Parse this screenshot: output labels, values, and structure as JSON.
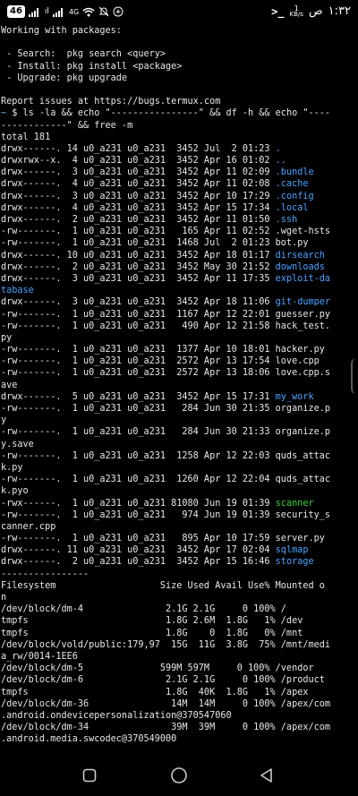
{
  "status_bar": {
    "battery": "46",
    "time": "١:٣٢",
    "ampm": "ص",
    "net_speed_value": "1",
    "net_speed_unit": "KB/s",
    "terminal_indicator": ">_",
    "signal_1": "ıl",
    "network_type": "4G"
  },
  "terminal": {
    "lines": [
      {
        "text": "Working with packages:",
        "cls": ""
      },
      {
        "text": "",
        "cls": ""
      },
      {
        "text": " - Search:  pkg search <query>",
        "cls": ""
      },
      {
        "text": " - Install: pkg install <package>",
        "cls": ""
      },
      {
        "text": " - Upgrade: pkg upgrade",
        "cls": ""
      },
      {
        "text": "",
        "cls": ""
      },
      {
        "text": "Report issues at https://bugs.termux.com",
        "cls": ""
      },
      {
        "text": "~ $ ls -la && echo \"----------------\" && df -h && echo \"----",
        "cls": "prompt"
      },
      {
        "text": "------------\" && free -m",
        "cls": ""
      },
      {
        "text": "total 181",
        "cls": ""
      },
      {
        "text": "drwx------. 14 u0_a231 u0_a231  3452 Jul  2 01:23 .",
        "cls": "",
        "tail": ".",
        "tail_cls": "dir-cyan"
      },
      {
        "text": "drwxrwx--x.  4 u0_a231 u0_a231  3452 Apr 16 01:02 ..",
        "cls": "",
        "tail": "..",
        "tail_cls": "dir-cyan"
      },
      {
        "text": "drwx------.  3 u0_a231 u0_a231  3452 Apr 11 02:09 .bundle",
        "cls": "",
        "tail": ".bundle",
        "tail_cls": "dir-cyan"
      },
      {
        "text": "drwx------.  4 u0_a231 u0_a231  3452 Apr 11 02:08 .cache",
        "cls": "",
        "tail": ".cache",
        "tail_cls": "dir-cyan"
      },
      {
        "text": "drwx------.  3 u0_a231 u0_a231  3452 Apr 10 17:29 .config",
        "cls": "",
        "tail": ".config",
        "tail_cls": "dir-cyan"
      },
      {
        "text": "drwx------.  4 u0_a231 u0_a231  3452 Apr 15 17:34 .local",
        "cls": "",
        "tail": ".local",
        "tail_cls": "dir-cyan"
      },
      {
        "text": "drwx------.  2 u0_a231 u0_a231  3452 Apr 11 01:50 .ssh",
        "cls": "",
        "tail": ".ssh",
        "tail_cls": "dir-cyan"
      },
      {
        "text": "-rw-------.  1 u0_a231 u0_a231   165 Apr 11 02:52 .wget-hsts",
        "cls": ""
      },
      {
        "text": "-rw-------.  1 u0_a231 u0_a231  1468 Jul  2 01:23 bot.py",
        "cls": ""
      },
      {
        "text": "drwx------. 10 u0_a231 u0_a231  3452 Apr 18 01:17 dirsearch",
        "cls": "",
        "tail": "dirsearch",
        "tail_cls": "dir-cyan"
      },
      {
        "text": "drwx------.  2 u0_a231 u0_a231  3452 May 30 21:52 downloads",
        "cls": "",
        "tail": "downloads",
        "tail_cls": "dir-cyan"
      },
      {
        "text": "drwx------.  3 u0_a231 u0_a231  3452 Apr 11 17:35 exploit-da",
        "cls": "",
        "tail": "exploit-da",
        "tail_cls": "dir-cyan"
      },
      {
        "text": "tabase",
        "cls": "dir-cyan"
      },
      {
        "text": "drwx------.  3 u0_a231 u0_a231  3452 Apr 18 11:06 git-dumper",
        "cls": "",
        "tail": "git-dumper",
        "tail_cls": "dir-cyan"
      },
      {
        "text": "-rw-------.  1 u0_a231 u0_a231  1167 Apr 12 22:01 guesser.py",
        "cls": ""
      },
      {
        "text": "-rw-------.  1 u0_a231 u0_a231   490 Apr 12 21:58 hack_test.",
        "cls": ""
      },
      {
        "text": "py",
        "cls": ""
      },
      {
        "text": "-rw-------.  1 u0_a231 u0_a231  1377 Apr 10 18:01 hacker.py",
        "cls": ""
      },
      {
        "text": "-rw-------.  1 u0_a231 u0_a231  2572 Apr 13 17:54 love.cpp",
        "cls": ""
      },
      {
        "text": "-rw-------.  1 u0_a231 u0_a231  2572 Apr 13 18:06 love.cpp.s",
        "cls": ""
      },
      {
        "text": "ave",
        "cls": ""
      },
      {
        "text": "drwx------.  5 u0_a231 u0_a231  3452 Apr 15 17:31 my_work",
        "cls": "",
        "tail": "my_work",
        "tail_cls": "dir-cyan"
      },
      {
        "text": "-rw-------.  1 u0_a231 u0_a231   284 Jun 30 21:35 organize.p",
        "cls": ""
      },
      {
        "text": "y",
        "cls": ""
      },
      {
        "text": "-rw-------.  1 u0_a231 u0_a231   284 Jun 30 21:33 organize.p",
        "cls": ""
      },
      {
        "text": "y.save",
        "cls": ""
      },
      {
        "text": "-rw-------.  1 u0_a231 u0_a231  1258 Apr 12 22:03 quds_attac",
        "cls": ""
      },
      {
        "text": "k.py",
        "cls": ""
      },
      {
        "text": "-rw-------.  1 u0_a231 u0_a231  1260 Apr 12 22:04 quds_attac",
        "cls": ""
      },
      {
        "text": "k.pyo",
        "cls": ""
      },
      {
        "text": "-rwx------.  1 u0_a231 u0_a231 81080 Jun 19 01:39 scanner",
        "cls": "",
        "tail": "scanner",
        "tail_cls": "exec-green"
      },
      {
        "text": "-rw-------.  1 u0_a231 u0_a231   974 Jun 19 01:39 security_s",
        "cls": ""
      },
      {
        "text": "canner.cpp",
        "cls": ""
      },
      {
        "text": "-rw-------.  1 u0_a231 u0_a231   895 Apr 10 17:59 server.py",
        "cls": ""
      },
      {
        "text": "drwx------. 11 u0_a231 u0_a231  3452 Apr 17 02:04 sqlmap",
        "cls": "",
        "tail": "sqlmap",
        "tail_cls": "dir-cyan"
      },
      {
        "text": "drwx------.  2 u0_a231 u0_a231  3452 Apr 15 16:46 storage",
        "cls": "",
        "tail": "storage",
        "tail_cls": "dir-cyan"
      },
      {
        "text": "----------------",
        "cls": ""
      },
      {
        "text": "Filesystem                   Size Used Avail Use% Mounted o",
        "cls": ""
      },
      {
        "text": "n",
        "cls": ""
      },
      {
        "text": "/dev/block/dm-4               2.1G 2.1G     0 100% /",
        "cls": ""
      },
      {
        "text": "tmpfs                         1.8G 2.6M  1.8G   1% /dev",
        "cls": ""
      },
      {
        "text": "tmpfs                         1.8G    0  1.8G   0% /mnt",
        "cls": ""
      },
      {
        "text": "/dev/block/vold/public:179,97  15G  11G  3.8G  75% /mnt/medi",
        "cls": ""
      },
      {
        "text": "a_rw/0014-1EE6",
        "cls": ""
      },
      {
        "text": "/dev/block/dm-5              599M 597M     0 100% /vendor",
        "cls": ""
      },
      {
        "text": "/dev/block/dm-6               2.1G 2.1G     0 100% /product",
        "cls": ""
      },
      {
        "text": "tmpfs                         1.8G  40K  1.8G   1% /apex",
        "cls": ""
      },
      {
        "text": "/dev/block/dm-36               14M  14M     0 100% /apex/com",
        "cls": ""
      },
      {
        "text": ".android.ondevicepersonalization@370547060",
        "cls": ""
      },
      {
        "text": "/dev/block/dm-34               39M  39M     0 100% /apex/com",
        "cls": ""
      },
      {
        "text": ".android.media.swcodec@370549000",
        "cls": ""
      }
    ]
  },
  "colors": {
    "background": "#000000",
    "text": "#e8e8e8",
    "directory": "#4aa3ff",
    "executable": "#38d430",
    "prompt": "#4fc3f7"
  },
  "nav": {
    "recent_icon": "recent-apps-icon",
    "home_icon": "home-circle-icon",
    "back_icon": "back-triangle-icon"
  }
}
